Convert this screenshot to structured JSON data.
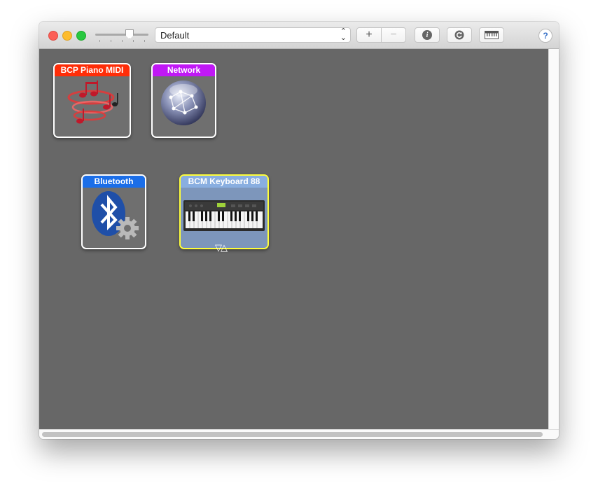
{
  "toolbar": {
    "configuration_select": {
      "value": "Default"
    },
    "add_label": "+",
    "remove_label": "−",
    "info_label": "i",
    "help_label": "?"
  },
  "devices": [
    {
      "name": "BCP Piano MIDI",
      "title_color": "#ff2d08",
      "icon": "midi-notes-icon",
      "selected": false
    },
    {
      "name": "Network",
      "title_color": "#c018f5",
      "icon": "network-globe-icon",
      "selected": false
    },
    {
      "name": "Bluetooth",
      "title_color": "#1b6ee8",
      "icon": "bluetooth-gear-icon",
      "selected": false
    },
    {
      "name": "BCM Keyboard 88",
      "title_color": "#89aee0",
      "icon": "piano-keyboard-icon",
      "selected": true
    }
  ],
  "colors": {
    "canvas": "#676767",
    "selection": "#ffff3a"
  }
}
